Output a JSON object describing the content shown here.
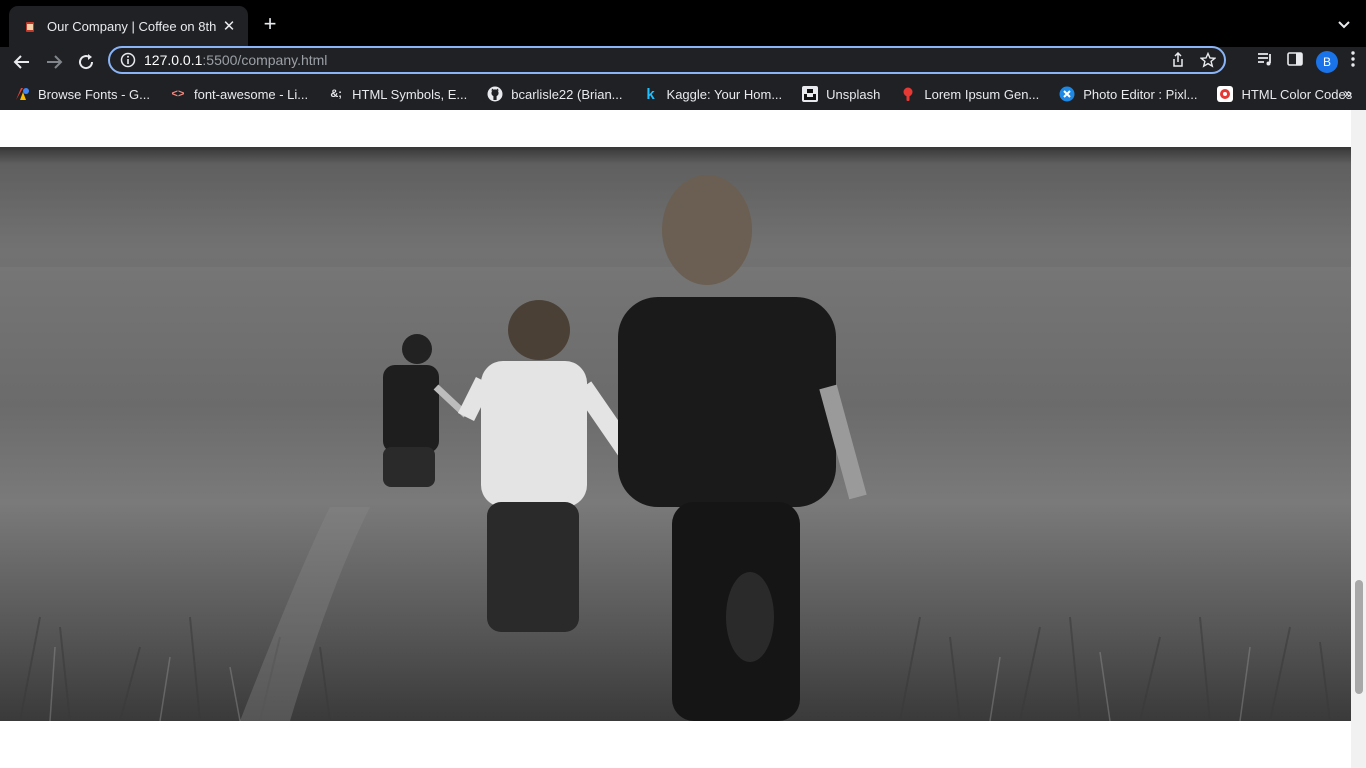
{
  "browser": {
    "tab": {
      "title": "Our Company | Coffee on 8th",
      "close_glyph": "✕"
    },
    "new_tab_glyph": "+",
    "url": {
      "host": "127.0.0.1",
      "rest": ":5500/company.html"
    },
    "profile_initial": "B"
  },
  "bookmarks": [
    {
      "label": "Browse Fonts - G...",
      "icon": "google-fonts-icon"
    },
    {
      "label": "font-awesome - Li...",
      "icon": "code-brackets-icon",
      "icon_text": "<>"
    },
    {
      "label": "HTML Symbols, E...",
      "icon": "ampersand-icon",
      "icon_text": "&;"
    },
    {
      "label": "bcarlisle22 (Brian...",
      "icon": "github-icon"
    },
    {
      "label": "Kaggle: Your Hom...",
      "icon": "kaggle-icon",
      "icon_text": "k"
    },
    {
      "label": "Unsplash",
      "icon": "unsplash-icon"
    },
    {
      "label": "Lorem Ipsum Gen...",
      "icon": "lorem-ipsum-icon"
    },
    {
      "label": "Photo Editor : Pixl...",
      "icon": "pixlr-icon"
    },
    {
      "label": "HTML Color Codes",
      "icon": "html-color-codes-icon"
    }
  ],
  "bookmarks_overflow": "»",
  "colors": {
    "omnibox_focus": "#8ab4f8",
    "avatar": "#1a73e8",
    "chrome_dark": "#202124"
  }
}
